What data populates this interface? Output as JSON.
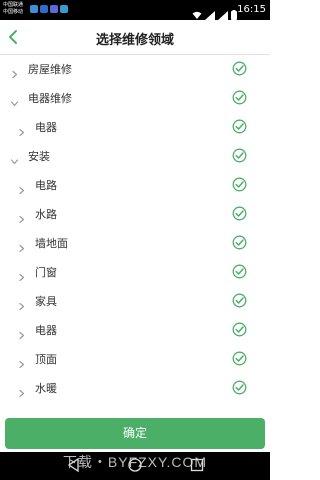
{
  "status_bar": {
    "carrier_1": "中国联通",
    "carrier_2": "中国移动",
    "time": "16:15"
  },
  "header": {
    "title": "选择维修领域"
  },
  "items": [
    {
      "label": "房屋维修",
      "level": 0,
      "expanded": false,
      "checked": true
    },
    {
      "label": "电器维修",
      "level": 0,
      "expanded": true,
      "checked": true
    },
    {
      "label": "电器",
      "level": 1,
      "expanded": false,
      "checked": true
    },
    {
      "label": "安装",
      "level": 0,
      "expanded": true,
      "checked": true
    },
    {
      "label": "电路",
      "level": 1,
      "expanded": false,
      "checked": true
    },
    {
      "label": "水路",
      "level": 1,
      "expanded": false,
      "checked": true
    },
    {
      "label": "墙地面",
      "level": 1,
      "expanded": false,
      "checked": true
    },
    {
      "label": "门窗",
      "level": 1,
      "expanded": false,
      "checked": true
    },
    {
      "label": "家具",
      "level": 1,
      "expanded": false,
      "checked": true
    },
    {
      "label": "电器",
      "level": 1,
      "expanded": false,
      "checked": true
    },
    {
      "label": "顶面",
      "level": 1,
      "expanded": false,
      "checked": true
    },
    {
      "label": "水暖",
      "level": 1,
      "expanded": false,
      "checked": true
    }
  ],
  "confirm_label": "确定",
  "watermark": "下载・BYFZXY.COM",
  "colors": {
    "accent": "#4caf68",
    "check": "#4caf68",
    "arrow": "#9a9a9a"
  }
}
